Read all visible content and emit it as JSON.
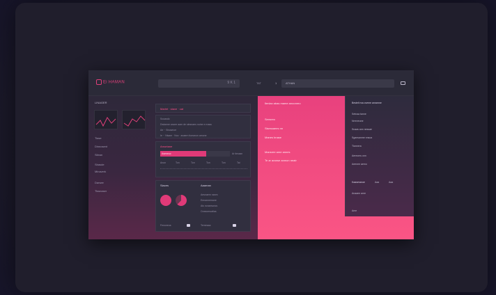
{
  "app": {
    "logo_text": "Ei HAMAN",
    "search_value": "9 K 1",
    "nav_label": "TAT",
    "nav_num": "1",
    "address_value": "ATHAN"
  },
  "sidebar": {
    "title": "LINAGER",
    "items": [
      "Tiase",
      "Dinnosent",
      "Silean",
      "Sbasde",
      "Minaverk",
      "Darsee",
      "Tissnaser"
    ]
  },
  "middle": {
    "card1": {
      "title": "Marlet · stave · cat",
      "line1": "Scuasdo",
      "line2": "Dwtanne ancee aam de stesnaes noine e rnass",
      "line3": "Ae ·· Bnuwnoe",
      "line4": "Ie ·· Nisam · Noc · anaern tioeanon amone"
    },
    "card2": {
      "title": "Amortane",
      "bar_label": "Aseneuc",
      "legend": "Ar tirnaan",
      "cols": [
        "Anon",
        "Ton",
        "Ton",
        "Ton",
        "Ton",
        "Tai"
      ],
      "progress": 0.66
    },
    "card3": {
      "title_left": "Siaces",
      "title_right": "Aaaman",
      "items": [
        "Aesnaem nanm",
        "Eenannemane",
        "Ais nonamunos",
        "Cneaomuatias"
      ],
      "foot_left": "Fenuneus",
      "foot_right": "Ternesaa"
    }
  },
  "pink": {
    "title": "Ilenlax abas mame anoonreo",
    "line1": "Sensreo",
    "line2": "Sisessaees nn",
    "line3": "Manes bnase",
    "line4": "Mansree ame annes",
    "line5": "Te ar aranse anmon neatr"
  },
  "right": {
    "title": "Bestelt ma oveme anramne",
    "items": [
      "Setnaa tanne",
      "Nrenreune",
      "Snaas ann nessae",
      "Sgansanme nnsoa",
      "Tiannera",
      "Aereoms onn",
      "Aeenee aemo",
      "Anaaee anre"
    ],
    "tag1": "Kaaseranoe",
    "tag2": "Aaa",
    "tag3": "Aaa",
    "footer": "Ame"
  },
  "colors": {
    "accent": "#ff4e88",
    "bg": "#1c1a2a"
  }
}
